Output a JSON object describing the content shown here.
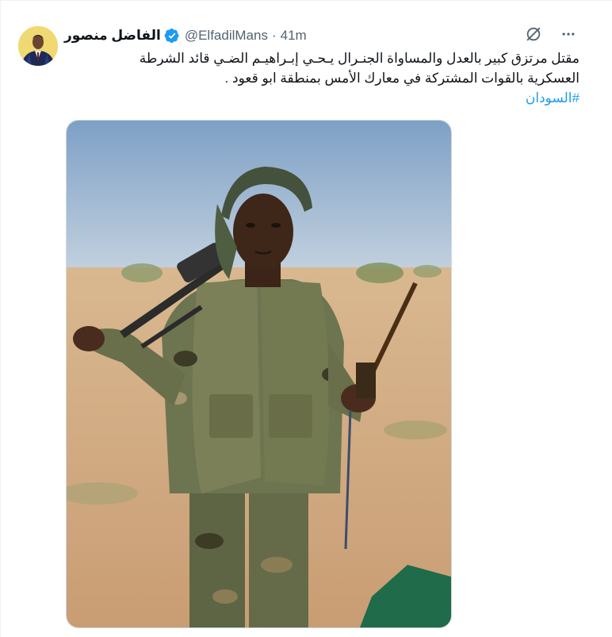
{
  "tweet": {
    "author_name": "الفاضل منصور",
    "handle": "@ElfadilMans",
    "separator": "·",
    "time": "41m",
    "text_line1": "مقتل مرتزق كبير بالعدل والمساواة الجنـرال يـحـي إبـراهيـم الضـي قائد الشرطة",
    "text_line2": "العسكرية بالقوات المشتركة في معارك الأمس بمنطقة ابو قعود .",
    "hashtag": "#السودان"
  },
  "colors": {
    "accent": "#1d9bf0",
    "secondary_text": "#536471",
    "primary_text": "#0f1419"
  },
  "icons": [
    "verified-badge-icon",
    "grok-icon",
    "more-options-icon"
  ]
}
